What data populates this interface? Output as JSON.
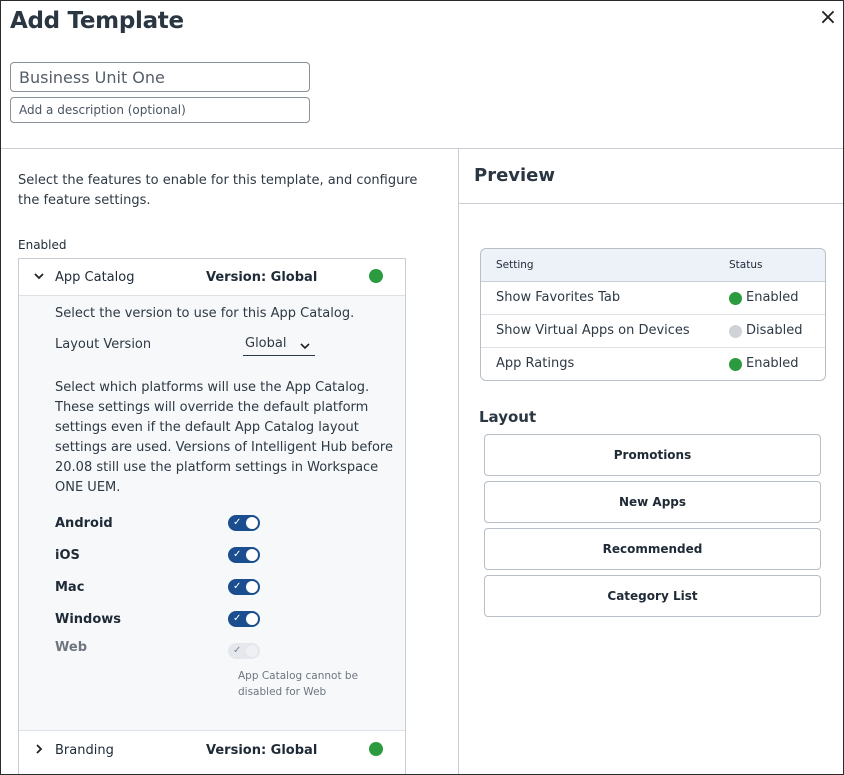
{
  "dialog": {
    "title": "Add Template",
    "close_glyph": "×",
    "name_value": "Business Unit One",
    "description_placeholder": "Add a description (optional)"
  },
  "left": {
    "intro": "Select the features to enable for this template, and configure the feature settings.",
    "enabled_label": "Enabled",
    "features": [
      {
        "name": "App Catalog",
        "version": "Version: Global",
        "status_color": "#2c9a3e",
        "expanded": true,
        "select_version_text": "Select the version to use for this App Catalog.",
        "layout_version_label": "Layout Version",
        "layout_version_value": "Global",
        "platforms_text": "Select which platforms will use the App Catalog. These settings will override the default platform settings even if the default App Catalog layout settings are used. Versions of Intelligent Hub before 20.08 still use the platform settings in Workspace ONE UEM.",
        "platforms": [
          {
            "label": "Android",
            "enabled": true
          },
          {
            "label": "iOS",
            "enabled": true
          },
          {
            "label": "Mac",
            "enabled": true
          },
          {
            "label": "Windows",
            "enabled": true
          },
          {
            "label": "Web",
            "enabled": true,
            "locked": true
          }
        ],
        "web_note": "App Catalog cannot be disabled for Web"
      },
      {
        "name": "Branding",
        "version": "Version: Global",
        "status_color": "#2c9a3e",
        "expanded": false
      }
    ]
  },
  "preview": {
    "title": "Preview",
    "table": {
      "headers": [
        "Setting",
        "Status"
      ],
      "rows": [
        {
          "setting": "Show Favorites Tab",
          "status": "Enabled",
          "color": "#2c9a3e"
        },
        {
          "setting": "Show Virtual Apps on Devices",
          "status": "Disabled",
          "color": "#cfd2d6"
        },
        {
          "setting": "App Ratings",
          "status": "Enabled",
          "color": "#2c9a3e"
        }
      ]
    },
    "layout_label": "Layout",
    "layout_items": [
      "Promotions",
      "New Apps",
      "Recommended",
      "Category List"
    ]
  }
}
